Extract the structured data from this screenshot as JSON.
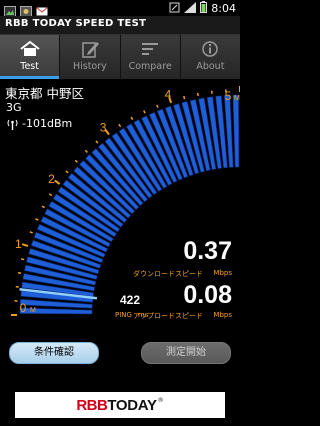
{
  "statusbar": {
    "time": "8:04"
  },
  "app": {
    "title": "RBB TODAY SPEED TEST"
  },
  "tabs": [
    {
      "label": "Test",
      "icon": "home-icon",
      "active": true
    },
    {
      "label": "History",
      "icon": "edit-icon",
      "active": false
    },
    {
      "label": "Compare",
      "icon": "list-icon",
      "active": false
    },
    {
      "label": "About",
      "icon": "info-icon",
      "active": false
    }
  ],
  "info": {
    "location": "東京都 中野区",
    "network": "3G",
    "signal": "-101dBm"
  },
  "gauge": {
    "ticks": [
      "0",
      "1",
      "2",
      "3",
      "4",
      "5"
    ],
    "unit_top": "M",
    "unit_bottom": "M",
    "max": 5,
    "current_download": 0.37
  },
  "results": {
    "download_value": "0.37",
    "download_label": "ダウンロードスピード",
    "download_unit": "Mbps",
    "upload_value": "0.08",
    "upload_label": "アップロードスピード",
    "upload_unit": "Mbps",
    "ping_value": "422",
    "ping_label": "PING",
    "ping_unit": "ms"
  },
  "buttons": {
    "conditions": "条件確認",
    "start": "測定開始"
  },
  "banner": {
    "part1": "RBB",
    "part2": "TODAY",
    "reg": "®"
  },
  "colors": {
    "accent": "#3aa0e6",
    "gauge_blue": "#1e5fd8",
    "label_orange": "#f0a020"
  }
}
